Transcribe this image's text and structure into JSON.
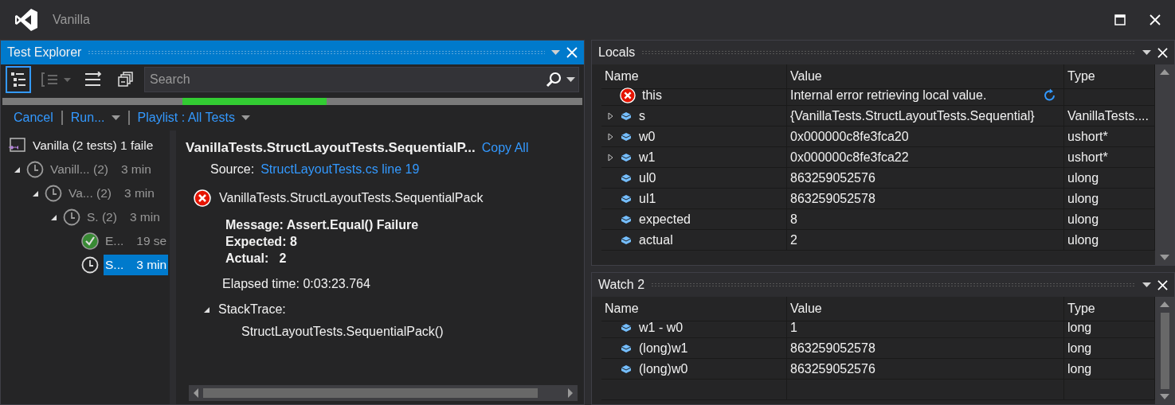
{
  "window": {
    "title": "Vanilla"
  },
  "test_explorer": {
    "title": "Test Explorer",
    "search": {
      "placeholder": "Search"
    },
    "commands": [
      {
        "label": "Cancel",
        "dropdown": false
      },
      {
        "label": "Run...",
        "dropdown": true
      },
      {
        "label": "Playlist : All Tests",
        "dropdown": true
      }
    ],
    "tree": [
      {
        "kind": "solution",
        "label": "Vanilla (2 tests) 1 faile",
        "selected": false,
        "children": [
          {
            "kind": "running",
            "label": "Vanill... (2)",
            "duration": "3 min",
            "expanded": true,
            "selected": false,
            "children": [
              {
                "kind": "running",
                "label": "Va... (2)",
                "duration": "3 min",
                "expanded": true,
                "selected": false,
                "children": [
                  {
                    "kind": "running",
                    "label": "S. (2)",
                    "duration": "3 min",
                    "expanded": true,
                    "selected": false,
                    "children": [
                      {
                        "kind": "passed",
                        "label": "E...",
                        "duration": "19 se",
                        "selected": false
                      },
                      {
                        "kind": "running",
                        "label": "S...",
                        "duration": "3 min",
                        "selected": true
                      }
                    ]
                  }
                ]
              }
            ]
          }
        ]
      }
    ],
    "details": {
      "title": "VanillaTests.StructLayoutTests.SequentialP...",
      "copy_link": "Copy All",
      "source_label": "Source:",
      "source_link": "StructLayoutTests.cs line 19",
      "test_name": "VanillaTests.StructLayoutTests.SequentialPack",
      "message_lines": [
        "Message: Assert.Equal() Failure",
        "Expected: 8",
        "Actual:   2"
      ],
      "elapsed": "Elapsed time: 0:03:23.764",
      "stack_label": "StackTrace:",
      "stack_expanded": true,
      "stack_lines": [
        "StructLayoutTests.SequentialPack()"
      ]
    }
  },
  "locals": {
    "title": "Locals",
    "columns": [
      "Name",
      "Value",
      "Type"
    ],
    "rows": [
      {
        "kind": "error",
        "expandable": false,
        "name": "this",
        "value": "Internal error retrieving local value.",
        "refresh": true
      },
      {
        "kind": "field",
        "expandable": true,
        "name": "s",
        "value": "{VanillaTests.StructLayoutTests.Sequential}",
        "refresh": false,
        "type": "VanillaTests...."
      },
      {
        "kind": "field",
        "expandable": true,
        "name": "w0",
        "value": "0x000000c8fe3fca20",
        "refresh": false,
        "type": "ushort*"
      },
      {
        "kind": "field",
        "expandable": true,
        "name": "w1",
        "value": "0x000000c8fe3fca22",
        "refresh": false,
        "type": "ushort*"
      },
      {
        "kind": "field",
        "expandable": false,
        "name": "ul0",
        "value": "863259052576",
        "refresh": false,
        "type": "ulong"
      },
      {
        "kind": "field",
        "expandable": false,
        "name": "ul1",
        "value": "863259052578",
        "refresh": false,
        "type": "ulong"
      },
      {
        "kind": "field",
        "expandable": false,
        "name": "expected",
        "value": "8",
        "refresh": false,
        "type": "ulong"
      },
      {
        "kind": "field",
        "expandable": false,
        "name": "actual",
        "value": "2",
        "refresh": false,
        "type": "ulong"
      }
    ]
  },
  "watch": {
    "title": "Watch 2",
    "columns": [
      "Name",
      "Value",
      "Type"
    ],
    "rows": [
      {
        "kind": "field",
        "expandable": false,
        "name": "w1 - w0",
        "value": "1",
        "refresh": false,
        "type": "long"
      },
      {
        "kind": "field",
        "expandable": false,
        "name": "(long)w1",
        "value": "863259052578",
        "refresh": false,
        "type": "long"
      },
      {
        "kind": "field",
        "expandable": false,
        "name": "(long)w0",
        "value": "863259052576",
        "refresh": false,
        "type": "long"
      }
    ]
  }
}
